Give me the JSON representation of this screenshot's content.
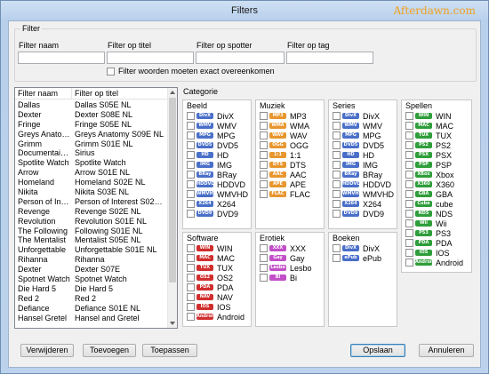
{
  "window": {
    "title": "Filters",
    "brand": "Afterdawn.com"
  },
  "filter": {
    "group_label": "Filter",
    "fields": [
      {
        "label": "Filter naam",
        "value": ""
      },
      {
        "label": "Filter op titel",
        "value": ""
      },
      {
        "label": "Filter op spotter",
        "value": ""
      },
      {
        "label": "Filter op tag",
        "value": ""
      }
    ],
    "exact_checkbox_label": "Filter woorden moeten exact overeenkomen"
  },
  "list": {
    "headers": [
      "Filter naam",
      "Filter op titel"
    ],
    "rows": [
      [
        "Dallas",
        "Dallas S05E NL"
      ],
      [
        "Dexter",
        "Dexter S08E NL"
      ],
      [
        "Fringe",
        "Fringe S05E NL"
      ],
      [
        "Greys Anatomy",
        "Greys Anatomy S09E NL"
      ],
      [
        "Grimm",
        "Grimm S01E NL"
      ],
      [
        "Documentaire Siri...",
        "Sirius"
      ],
      [
        "Spotlite Watch",
        "Spotlite Watch"
      ],
      [
        "Arrow",
        "Arrow S01E NL"
      ],
      [
        "Homeland",
        "Homeland S02E NL"
      ],
      [
        "Nikita",
        "Nikita S03E NL"
      ],
      [
        "Person of Interest",
        "Person of Interest S02E NL"
      ],
      [
        "Revenge",
        "Revenge S02E NL"
      ],
      [
        "Revolution",
        "Revolution S01E NL"
      ],
      [
        "The Following",
        "Following S01E NL"
      ],
      [
        "The Mentalist",
        "Mentalist S05E NL"
      ],
      [
        "Unforgettable",
        "Unforgettable S01E NL"
      ],
      [
        "Rihanna",
        "Rihanna"
      ],
      [
        "Dexter",
        "Dexter S07E"
      ],
      [
        "Spotnet Watch",
        "Spotnet Watch"
      ],
      [
        "Die Hard 5",
        "Die Hard 5"
      ],
      [
        "Red 2",
        "Red 2"
      ],
      [
        "Defiance",
        "Defiance S01E NL"
      ],
      [
        "Hansel Gretel",
        "Hansel and Gretel"
      ]
    ]
  },
  "categorie": {
    "label": "Categorie",
    "groups": [
      {
        "title": "Beeld",
        "items": [
          {
            "badge": "DivX",
            "color": "#4a6fc9",
            "label": "DivX"
          },
          {
            "badge": "WMV",
            "color": "#4a6fc9",
            "label": "WMV"
          },
          {
            "badge": "MPG",
            "color": "#4a6fc9",
            "label": "MPG"
          },
          {
            "badge": "DVD5",
            "color": "#4a6fc9",
            "label": "DVD5"
          },
          {
            "badge": "HD",
            "color": "#4a6fc9",
            "label": "HD"
          },
          {
            "badge": "IMG",
            "color": "#4a6fc9",
            "label": "IMG"
          },
          {
            "badge": "BRay",
            "color": "#4a6fc9",
            "label": "BRay"
          },
          {
            "badge": "HDDVD",
            "color": "#4a6fc9",
            "label": "HDDVD"
          },
          {
            "badge": "WMVHD",
            "color": "#4a6fc9",
            "label": "WMVHD"
          },
          {
            "badge": "X264",
            "color": "#4a6fc9",
            "label": "X264"
          },
          {
            "badge": "DVD9",
            "color": "#4a6fc9",
            "label": "DVD9"
          }
        ]
      },
      {
        "title": "Muziek",
        "items": [
          {
            "badge": "MP3",
            "color": "#e8962e",
            "label": "MP3"
          },
          {
            "badge": "WMA",
            "color": "#e8962e",
            "label": "WMA"
          },
          {
            "badge": "WAV",
            "color": "#e8962e",
            "label": "WAV"
          },
          {
            "badge": "OGG",
            "color": "#e8962e",
            "label": "OGG"
          },
          {
            "badge": "1:1",
            "color": "#e8962e",
            "label": "1:1"
          },
          {
            "badge": "DTS",
            "color": "#e8962e",
            "label": "DTS"
          },
          {
            "badge": "AAC",
            "color": "#e8962e",
            "label": "AAC"
          },
          {
            "badge": "APE",
            "color": "#e8962e",
            "label": "APE"
          },
          {
            "badge": "FLAC",
            "color": "#e8962e",
            "label": "FLAC"
          }
        ]
      },
      {
        "title": "Series",
        "items": [
          {
            "badge": "DivX",
            "color": "#4a6fc9",
            "label": "DivX"
          },
          {
            "badge": "WMV",
            "color": "#4a6fc9",
            "label": "WMV"
          },
          {
            "badge": "MPG",
            "color": "#4a6fc9",
            "label": "MPG"
          },
          {
            "badge": "DVD5",
            "color": "#4a6fc9",
            "label": "DVD5"
          },
          {
            "badge": "HD",
            "color": "#4a6fc9",
            "label": "HD"
          },
          {
            "badge": "IMG",
            "color": "#4a6fc9",
            "label": "IMG"
          },
          {
            "badge": "BRay",
            "color": "#4a6fc9",
            "label": "BRay"
          },
          {
            "badge": "HDDVD",
            "color": "#4a6fc9",
            "label": "HDDVD"
          },
          {
            "badge": "WMVHD",
            "color": "#4a6fc9",
            "label": "WMVHD"
          },
          {
            "badge": "X264",
            "color": "#4a6fc9",
            "label": "X264"
          },
          {
            "badge": "DVD9",
            "color": "#4a6fc9",
            "label": "DVD9"
          }
        ]
      },
      {
        "title": "Spellen",
        "items": [
          {
            "badge": "WIN",
            "color": "#2e9e3a",
            "label": "WIN"
          },
          {
            "badge": "MAC",
            "color": "#2e9e3a",
            "label": "MAC"
          },
          {
            "badge": "TUX",
            "color": "#2e9e3a",
            "label": "TUX"
          },
          {
            "badge": "PS2",
            "color": "#2e9e3a",
            "label": "PS2"
          },
          {
            "badge": "PSX",
            "color": "#2e9e3a",
            "label": "PSX"
          },
          {
            "badge": "PSP",
            "color": "#2e9e3a",
            "label": "PSP"
          },
          {
            "badge": "XBox",
            "color": "#2e9e3a",
            "label": "Xbox"
          },
          {
            "badge": "X360",
            "color": "#2e9e3a",
            "label": "X360"
          },
          {
            "badge": "GBA",
            "color": "#2e9e3a",
            "label": "GBA"
          },
          {
            "badge": "Cube",
            "color": "#2e9e3a",
            "label": "cube"
          },
          {
            "badge": "NDS",
            "color": "#2e9e3a",
            "label": "NDS"
          },
          {
            "badge": "Wii",
            "color": "#2e9e3a",
            "label": "Wii"
          },
          {
            "badge": "PS3",
            "color": "#2e9e3a",
            "label": "PS3"
          },
          {
            "badge": "PDA",
            "color": "#2e9e3a",
            "label": "PDA"
          },
          {
            "badge": "IOS",
            "color": "#2e9e3a",
            "label": "IOS"
          },
          {
            "badge": "Android",
            "color": "#2e9e3a",
            "label": "Android"
          }
        ]
      },
      {
        "title": "Software",
        "items": [
          {
            "badge": "WIN",
            "color": "#d02e2e",
            "label": "WIN"
          },
          {
            "badge": "MAC",
            "color": "#d02e2e",
            "label": "MAC"
          },
          {
            "badge": "TUX",
            "color": "#d02e2e",
            "label": "TUX"
          },
          {
            "badge": "OS2",
            "color": "#d02e2e",
            "label": "OS2"
          },
          {
            "badge": "PDA",
            "color": "#d02e2e",
            "label": "PDA"
          },
          {
            "badge": "NAV",
            "color": "#d02e2e",
            "label": "NAV"
          },
          {
            "badge": "IOS",
            "color": "#d02e2e",
            "label": "IOS"
          },
          {
            "badge": "Android",
            "color": "#d02e2e",
            "label": "Android"
          }
        ]
      },
      {
        "title": "Erotiek",
        "items": [
          {
            "badge": "XXX",
            "color": "#c24fc8",
            "label": "XXX"
          },
          {
            "badge": "Gay",
            "color": "#c24fc8",
            "label": "Gay"
          },
          {
            "badge": "Lesbo",
            "color": "#c24fc8",
            "label": "Lesbo"
          },
          {
            "badge": "Bi",
            "color": "#c24fc8",
            "label": "Bi"
          }
        ]
      },
      {
        "title": "Boeken",
        "items": [
          {
            "badge": "DivX",
            "color": "#4a6fc9",
            "label": "DivX"
          },
          {
            "badge": "ePub",
            "color": "#4a6fc9",
            "label": "ePub"
          }
        ]
      }
    ]
  },
  "buttons": {
    "remove": "Verwijderen",
    "add": "Toevoegen",
    "apply": "Toepassen",
    "save": "Opslaan",
    "cancel": "Annuleren"
  }
}
